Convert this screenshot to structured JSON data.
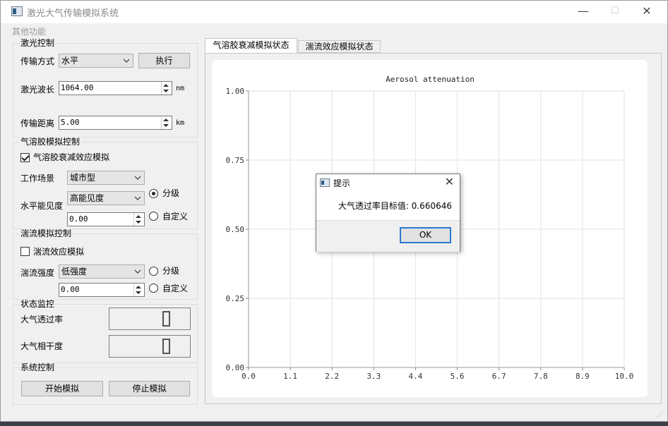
{
  "window": {
    "title": "激光大气传输模拟系统",
    "minimize": "—",
    "maximize": "☐",
    "close": "✕"
  },
  "menu": {
    "items": [
      "其他功能"
    ]
  },
  "laser": {
    "group_title": "激光控制",
    "mode_label": "传输方式",
    "mode_value": "水平",
    "execute_label": "执行",
    "wavelength_label": "激光波长",
    "wavelength_value": "1064.00",
    "wavelength_unit": "nm",
    "distance_label": "传输距离",
    "distance_value": "5.00",
    "distance_unit": "km"
  },
  "aerosol": {
    "group_title": "气溶胶模拟控制",
    "enable_label": "气溶胶衰减效应模拟",
    "enable_checked": true,
    "scene_label": "工作场景",
    "scene_value": "城市型",
    "visibility_label": "水平能见度",
    "visibility_value": "高能见度",
    "visibility_input": "0.00",
    "radio_graded": "分级",
    "radio_custom": "自定义",
    "selected": "graded"
  },
  "turbulence": {
    "group_title": "湍流模拟控制",
    "enable_label": "湍流效应模拟",
    "enable_checked": false,
    "strength_label": "湍流强度",
    "strength_value": "低强度",
    "strength_input": "0.00",
    "radio_graded": "分级",
    "radio_custom": "自定义",
    "selected": "none"
  },
  "monitor": {
    "group_title": "状态监控",
    "transmittance_label": "大气透过率",
    "transmittance_value": "0",
    "coherence_label": "大气相干度",
    "coherence_value": "0"
  },
  "system": {
    "group_title": "系统控制",
    "start_label": "开始模拟",
    "stop_label": "停止模拟"
  },
  "tabs": [
    {
      "label": "气溶胶衰减模拟状态",
      "active": true
    },
    {
      "label": "湍流效应模拟状态",
      "active": false
    }
  ],
  "chart_data": {
    "type": "line",
    "title": "Aerosol attenuation",
    "xlabel": "",
    "ylabel": "",
    "xlim": [
      0,
      10
    ],
    "ylim": [
      0,
      1
    ],
    "x_ticks": [
      "0.0",
      "1.1",
      "2.2",
      "3.3",
      "4.4",
      "5.6",
      "6.7",
      "7.8",
      "8.9",
      "10.0"
    ],
    "y_ticks": [
      "0.00",
      "0.25",
      "0.50",
      "0.75",
      "1.00"
    ],
    "grid": true,
    "series": []
  },
  "dialog": {
    "title": "提示",
    "message": "大气透过率目标值: 0.660646",
    "ok_label": "OK",
    "close": "✕"
  }
}
